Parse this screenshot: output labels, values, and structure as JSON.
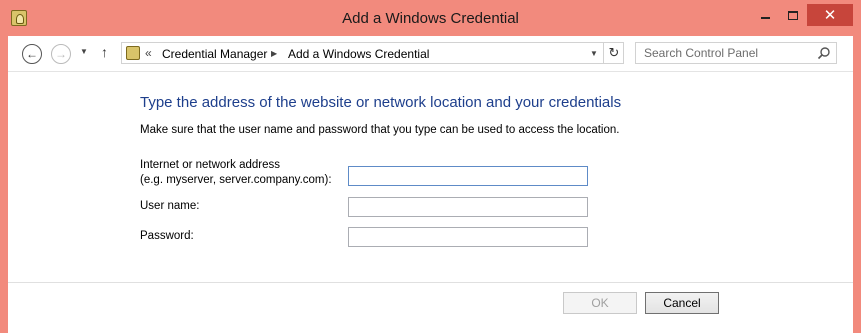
{
  "window": {
    "title": "Add a Windows Credential",
    "close_glyph": "✕"
  },
  "nav": {
    "back_icon": "arrow-left-icon",
    "forward_icon": "arrow-right-icon",
    "up_icon": "arrow-up-icon",
    "breadcrumb_prefix": "«",
    "breadcrumbs": [
      "Credential Manager",
      "Add a Windows Credential"
    ],
    "search_placeholder": "Search Control Panel"
  },
  "content": {
    "heading": "Type the address of the website or network location and your credentials",
    "instruction": "Make sure that the user name and password that you type can be used to access the location.",
    "address_label_line1": "Internet or network address",
    "address_label_line2": "(e.g. myserver, server.company.com):",
    "address_value": "",
    "username_label": "User name:",
    "username_value": "",
    "password_label": "Password:",
    "password_value": ""
  },
  "buttons": {
    "ok": "OK",
    "cancel": "Cancel"
  },
  "colors": {
    "titlebar": "#f28a7d",
    "close_button": "#c7453b",
    "heading": "#1e3f8c"
  }
}
